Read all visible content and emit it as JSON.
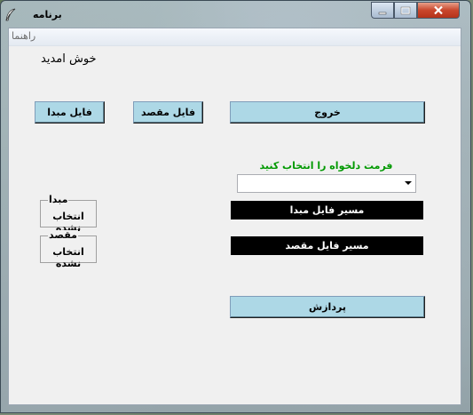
{
  "window": {
    "title": "برنامه",
    "controls": [
      "minimize-icon",
      "maximize-icon",
      "close-icon"
    ]
  },
  "menu": {
    "items": [
      "راهنما"
    ]
  },
  "welcome_text": "خوش امدید",
  "buttons": {
    "source_file": "فایل مبدا",
    "dest_file": "فایل مقصد",
    "exit": "خروج",
    "process": "پردازش"
  },
  "format": {
    "label": "فرمت دلخواه را انتخاب کنید",
    "selected": ""
  },
  "paths": {
    "source": "مسیر فایل مبدا",
    "dest": "مسیر فایل مقصد"
  },
  "groups": {
    "source": {
      "title": "مبدا",
      "value": "انتخاب نشده"
    },
    "dest": {
      "title": "مقصد",
      "value": "انتخاب نشده"
    }
  },
  "colors": {
    "button_bg": "#add8e6",
    "format_label": "#009900",
    "path_bg": "#000000"
  }
}
